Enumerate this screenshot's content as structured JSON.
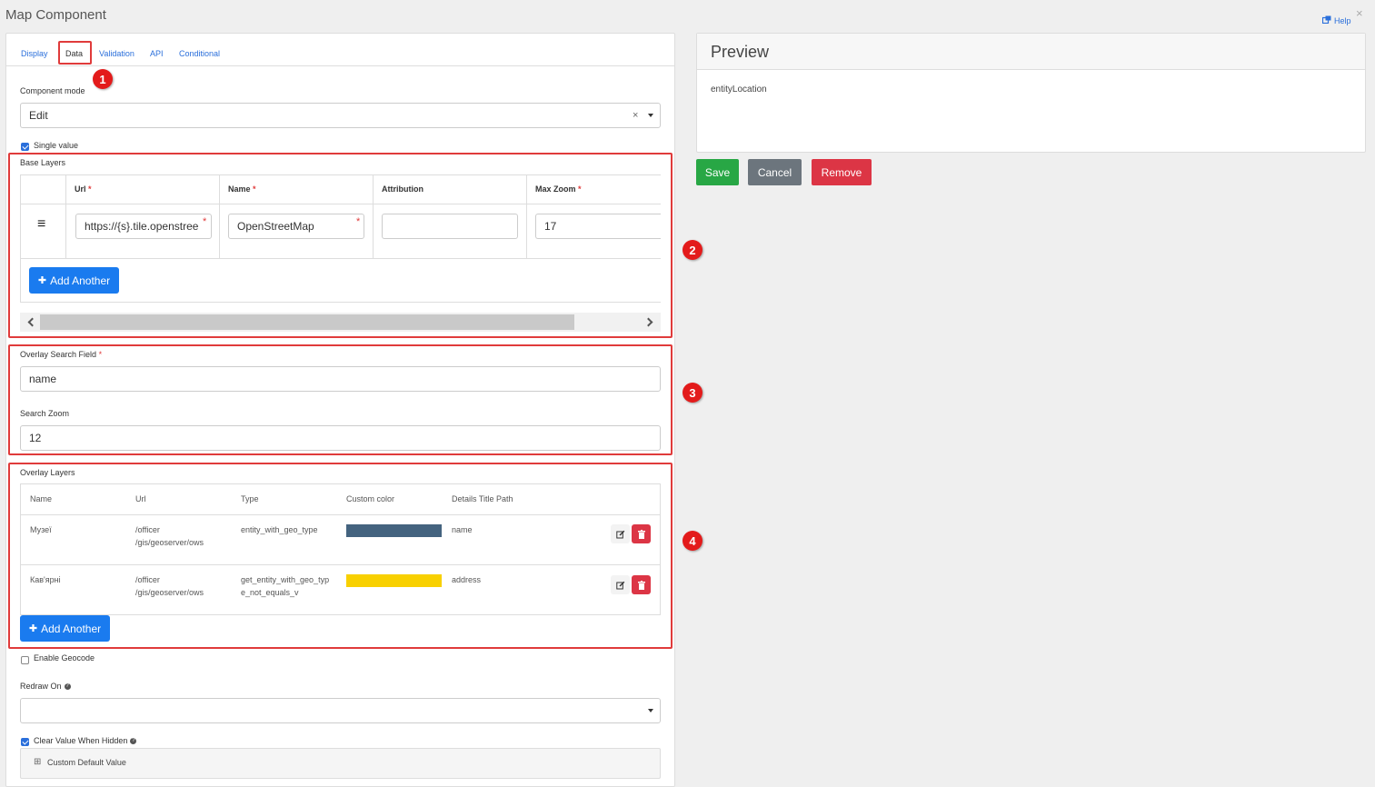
{
  "window": {
    "title": "Map Component",
    "help_label": "Help",
    "close_glyph": "×"
  },
  "tabs": [
    {
      "label": "Display",
      "active": false
    },
    {
      "label": "Data",
      "active": true
    },
    {
      "label": "Validation",
      "active": false
    },
    {
      "label": "API",
      "active": false
    },
    {
      "label": "Conditional",
      "active": false
    }
  ],
  "markers": [
    "1",
    "2",
    "3",
    "4"
  ],
  "form": {
    "component_mode": {
      "label": "Component mode",
      "value": "Edit",
      "clear_glyph": "×"
    },
    "single_value": {
      "label": "Single value",
      "checked": true
    },
    "base_layers": {
      "label": "Base Layers",
      "columns": [
        {
          "label": "Url",
          "required": "*"
        },
        {
          "label": "Name",
          "required": "*"
        },
        {
          "label": "Attribution",
          "required": ""
        },
        {
          "label": "Max Zoom",
          "required": "*"
        }
      ],
      "row": {
        "drag_glyph": "≡",
        "url": "https://{s}.tile.openstree",
        "name": "OpenStreetMap",
        "attribution": "",
        "max_zoom": "17",
        "required_mark": "*"
      },
      "add_another": "Add Another",
      "plus_glyph": "✚"
    },
    "overlay_search_field": {
      "label": "Overlay Search Field",
      "required": "*",
      "value": "name"
    },
    "search_zoom": {
      "label": "Search Zoom",
      "value": "12"
    },
    "overlay_layers": {
      "label": "Overlay Layers",
      "columns": [
        "Name",
        "Url",
        "Type",
        "Custom color",
        "Details Title Path"
      ],
      "rows": [
        {
          "name": "Музеї",
          "url_line1": "/officer",
          "url_line2": "/gis/geoserver/ows",
          "type_line1": "entity_with_geo_type",
          "type_line2": "",
          "color": "#44637f",
          "path": "name"
        },
        {
          "name": "Кав'ярні",
          "url_line1": "/officer",
          "url_line2": "/gis/geoserver/ows",
          "type_line1": "get_entity_with_geo_typ",
          "type_line2": "e_not_equals_v",
          "color": "#f8d000",
          "path": "address"
        }
      ],
      "add_another": "Add Another",
      "plus_glyph": "✚"
    },
    "enable_geocode": {
      "label": "Enable Geocode",
      "checked": false
    },
    "redraw_on": {
      "label": "Redraw On",
      "value": ""
    },
    "clear_value_when_hidden": {
      "label": "Clear Value When Hidden",
      "checked": true
    },
    "custom_default_value": {
      "label": "Custom Default Value",
      "expand_glyph": "⊞"
    },
    "help_glyph": "?"
  },
  "preview": {
    "title": "Preview",
    "field_label": "entityLocation"
  },
  "actions": {
    "save": "Save",
    "cancel": "Cancel",
    "remove": "Remove"
  },
  "colors": {
    "accent": "#1a7bef",
    "save": "#28a745",
    "cancel": "#6c757d",
    "remove": "#dc3545",
    "annotation": "#e03b3b"
  }
}
